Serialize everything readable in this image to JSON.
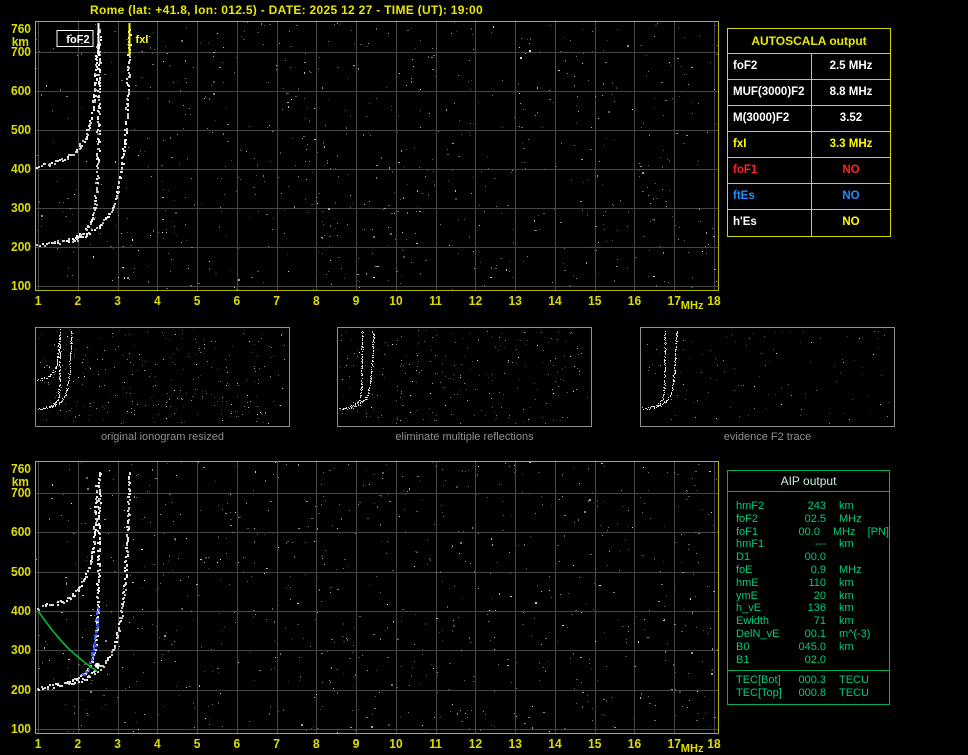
{
  "header": {
    "title": "Rome (lat: +41.8, lon: 012.5) - DATE: 2025 12 27 - TIME (UT): 19:00"
  },
  "autoscala_table": {
    "title": "AUTOSCALA output",
    "rows": [
      {
        "label": "foF2",
        "value": "2.5 MHz",
        "color": "#ffffff"
      },
      {
        "label": "MUF(3000)F2",
        "value": "8.8 MHz",
        "color": "#ffffff"
      },
      {
        "label": "M(3000)F2",
        "value": "3.52",
        "color": "#ffffff"
      },
      {
        "label": "fxI",
        "value": "3.3 MHz",
        "color": "#ffff00"
      },
      {
        "label": "foF1",
        "value": "NO",
        "color": "#ff2222"
      },
      {
        "label": "ftEs",
        "value": "NO",
        "color": "#1e8fff"
      },
      {
        "label": "h'Es",
        "value": "NO",
        "color": "#ffffff",
        "value_color": "#ffff00"
      }
    ]
  },
  "thumbnails": [
    {
      "caption": "original ionogram resized"
    },
    {
      "caption": "eliminate multiple reflections"
    },
    {
      "caption": "evidence F2 trace"
    }
  ],
  "aip_table": {
    "title": "AIP output",
    "rows": [
      {
        "label": "hmF2",
        "value": "243",
        "unit": "km",
        "note": ""
      },
      {
        "label": "foF2",
        "value": "02.5",
        "unit": "MHz",
        "note": ""
      },
      {
        "label": "foF1",
        "value": "00.0",
        "unit": "MHz",
        "note": "[PN]"
      },
      {
        "label": "hmF1",
        "value": "---",
        "unit": "km",
        "note": ""
      },
      {
        "label": "D1",
        "value": "00.0",
        "unit": "",
        "note": ""
      },
      {
        "label": "foE",
        "value": "0.9",
        "unit": "MHz",
        "note": ""
      },
      {
        "label": "hmE",
        "value": "110",
        "unit": "km",
        "note": ""
      },
      {
        "label": "ymE",
        "value": "20",
        "unit": "km",
        "note": ""
      },
      {
        "label": "h_vE",
        "value": "136",
        "unit": "km",
        "note": ""
      },
      {
        "label": "Ewidth",
        "value": "71",
        "unit": "km",
        "note": ""
      },
      {
        "label": "DelN_vE",
        "value": "00.1",
        "unit": "m^(-3)",
        "note": ""
      },
      {
        "label": "B0",
        "value": "045.0",
        "unit": "km",
        "note": ""
      },
      {
        "label": "B1",
        "value": "02.0",
        "unit": "",
        "note": ""
      }
    ],
    "tec_rows": [
      {
        "label": "TEC[Bot]",
        "value": "000.3",
        "unit": "TECU",
        "note": ""
      },
      {
        "label": "TEC[Top]",
        "value": "000.8",
        "unit": "TECU",
        "note": ""
      }
    ]
  },
  "chart_data": {
    "type": "scatter",
    "description": "Vertical-incidence ionogram (virtual height km vs frequency MHz) with AUTOSCALA autoscaling output",
    "style": {
      "grid": "#454545",
      "frame": "#b5b500",
      "ticks": "#dcdc00"
    },
    "trace_library": {
      "f2_ordinary": [
        [
          1.0,
          205
        ],
        [
          1.25,
          208
        ],
        [
          1.5,
          212
        ],
        [
          1.75,
          218
        ],
        [
          1.95,
          226
        ],
        [
          2.1,
          236
        ],
        [
          2.25,
          250
        ],
        [
          2.35,
          270
        ],
        [
          2.42,
          298
        ],
        [
          2.47,
          345
        ],
        [
          2.5,
          420
        ],
        [
          2.52,
          530
        ],
        [
          2.53,
          660
        ],
        [
          2.54,
          755
        ]
      ],
      "f2_extraordinary": [
        [
          1.75,
          215
        ],
        [
          2.0,
          222
        ],
        [
          2.2,
          231
        ],
        [
          2.4,
          243
        ],
        [
          2.6,
          258
        ],
        [
          2.75,
          278
        ],
        [
          2.9,
          305
        ],
        [
          3.0,
          340
        ],
        [
          3.1,
          395
        ],
        [
          3.18,
          470
        ],
        [
          3.24,
          570
        ],
        [
          3.28,
          680
        ],
        [
          3.3,
          755
        ]
      ],
      "second_hop": [
        [
          1.0,
          408
        ],
        [
          1.3,
          414
        ],
        [
          1.6,
          424
        ],
        [
          1.85,
          438
        ],
        [
          2.05,
          458
        ],
        [
          2.2,
          484
        ],
        [
          2.32,
          522
        ],
        [
          2.4,
          575
        ],
        [
          2.45,
          645
        ],
        [
          2.48,
          720
        ]
      ],
      "profile_green": [
        [
          1.0,
          400
        ],
        [
          1.2,
          372
        ],
        [
          1.4,
          346
        ],
        [
          1.6,
          322
        ],
        [
          1.8,
          301
        ],
        [
          2.0,
          284
        ],
        [
          2.15,
          271
        ],
        [
          2.3,
          260
        ],
        [
          2.4,
          253
        ],
        [
          2.5,
          246
        ]
      ],
      "restored_blue": [
        [
          2.12,
          238
        ],
        [
          2.22,
          250
        ],
        [
          2.3,
          265
        ],
        [
          2.37,
          285
        ],
        [
          2.43,
          315
        ],
        [
          2.47,
          360
        ],
        [
          2.49,
          410
        ]
      ]
    },
    "ionogram_top": {
      "xlabel": "MHz",
      "ylabel": "km",
      "xlim": [
        1,
        18
      ],
      "ylim": [
        100,
        760
      ],
      "x_ticks": [
        1,
        2,
        3,
        4,
        5,
        6,
        7,
        8,
        9,
        10,
        11,
        12,
        13,
        14,
        15,
        16,
        17,
        18
      ],
      "y_ticks": [
        760,
        700,
        600,
        500,
        400,
        300,
        200,
        100
      ],
      "grid": true,
      "traces": [
        "f2_ordinary",
        "f2_extraordinary",
        "second_hop"
      ],
      "markers": [
        {
          "label": "foF2",
          "x": 2.5,
          "color": "#ffffff",
          "side": "left",
          "boxed": true
        },
        {
          "label": "fxI",
          "x": 3.3,
          "color": "#ffff00",
          "side": "right",
          "boxed": false
        }
      ],
      "noise": 800,
      "seed": 11
    },
    "ionogram_bottom": {
      "xlabel": "MHz",
      "ylabel": "km",
      "xlim": [
        1,
        18
      ],
      "ylim": [
        100,
        760
      ],
      "x_ticks": [
        1,
        2,
        3,
        4,
        5,
        6,
        7,
        8,
        9,
        10,
        11,
        12,
        13,
        14,
        15,
        16,
        17,
        18
      ],
      "y_ticks": [
        760,
        700,
        600,
        500,
        400,
        300,
        200,
        100
      ],
      "grid": true,
      "traces": [
        "f2_ordinary",
        "f2_extraordinary",
        "second_hop"
      ],
      "profile": "profile_green",
      "profile_color": "#00bb33",
      "restored": "restored_blue",
      "restored_color": "#3a5cff",
      "hmF2_point": {
        "x": 2.49,
        "y": 262
      },
      "noise": 850,
      "seed": 23
    },
    "thumbs": [
      {
        "traces": [
          "f2_ordinary",
          "f2_extraordinary",
          "second_hop"
        ],
        "noise": 300,
        "seed": 5
      },
      {
        "traces": [
          "f2_ordinary",
          "f2_extraordinary"
        ],
        "noise": 240,
        "seed": 6
      },
      {
        "traces": [
          "f2_ordinary",
          "f2_extraordinary"
        ],
        "noise": 110,
        "seed": 7
      }
    ]
  }
}
